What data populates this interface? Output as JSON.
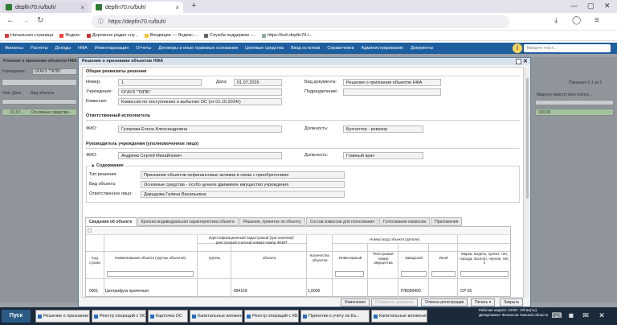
{
  "browser": {
    "tabs": [
      {
        "title": "depfin70.ru/buh/"
      },
      {
        "title": "depfin70.ru/buh/"
      }
    ],
    "address": "https://depfin70.ru/buh/",
    "bookmarks": [
      {
        "label": "Начальная страница",
        "color": "#e53935"
      },
      {
        "label": "Яндекс",
        "color": "#f44336"
      },
      {
        "label": "Дорожное радио слу...",
        "color": "#d32f2f"
      },
      {
        "label": "Входящие — Яндекс....",
        "color": "#fbc02d"
      },
      {
        "label": "Служба поддержки -...",
        "color": "#616161"
      },
      {
        "label": "https://buh.depfin70.r...",
        "color": "#90a4ae"
      }
    ]
  },
  "app": {
    "nav": [
      "Финансы",
      "Расчеты",
      "Доходы",
      "НФА",
      "Инвентаризация",
      "Отчеты",
      "Договоры и иные правовые основания",
      "Целевые средства",
      "Ввод остатков",
      "Справочники",
      "Администрирование",
      "Документы"
    ],
    "search_placeholder": "Введите текст..."
  },
  "background": {
    "title": "Решение о признании объектов НФА",
    "org_label": "Учреждение:",
    "org_value": "ОГАУЗ \"ТКПБ\"",
    "col_num": "Ном",
    "col_date": "Дата",
    "col_type": "Вид объекта",
    "row_date": "01.07...",
    "row_type": "Основные средства -",
    "shown": "Показано 1-1 из 1",
    "right_col": "Кварууп присутствие голосу...",
    "right_val": "100,00"
  },
  "dialog": {
    "title": "Решение о признании объектов НФА",
    "general": {
      "header": "Общие реквизиты решения",
      "num_label": "Номер:",
      "num_value": "1",
      "date_label": "Дата:",
      "date_value": "01.07.2026",
      "doctype_label": "Вид документа:",
      "doctype_value": "Решение о признании объектов НФА",
      "org_label": "Учреждение:",
      "org_value": "ОГАУЗ \"ТКПБ\"",
      "dept_label": "Подразделение:",
      "dept_value": "",
      "comm_label": "Комиссия:",
      "comm_value": "Комиссия по поступлению и выбытию ОС (от 01.10.2024г)"
    },
    "executor": {
      "header": "Ответственный исполнитель",
      "fio_label": "ФИО:",
      "fio_value": "Гучерова Елена Александровна",
      "pos_label": "Должность:",
      "pos_value": "Бухгалтер - ревизор"
    },
    "head": {
      "header": "Руководитель учреждения (уполномоченное лицо)",
      "fio_label": "ФИО:",
      "fio_value": "Андреев Сергей Михайлович",
      "pos_label": "Должность:",
      "pos_value": "Главный врач"
    },
    "content": {
      "header": "Содержание",
      "type_label": "Тип решения:",
      "type_value": "Признание объектов нефинансовых активов в связи с приобретением",
      "obj_label": "Вид объекта:",
      "obj_value": "Основные средства - особо ценное движимое имущество учреждения",
      "resp_label": "Ответственное лицо:",
      "resp_value": "Давыдова Галина Васильевна"
    },
    "tabs": [
      "Сведения об объекте",
      "Краткая индивидуальная характеристика объекта",
      "Решение, принятое по объекту",
      "Состав комиссии для голосования",
      "Голосование комиссии",
      "Приложения"
    ],
    "table": {
      "toolbar_hint": "",
      "hdr_idnum": "Идентификационный/ кадастровый (при наличии)/ реестровый/ учетный номер/ номер ФАИП",
      "hdr_code": "Номер (код) объекта (детали)",
      "hdr_kod": "Код строки",
      "hdr_name": "Наименование объекта (группы объектов)",
      "hdr_group": "группы",
      "hdr_object": "объекта",
      "hdr_qty": "Количество объектов",
      "hdr_inv": "Инвентарный",
      "hdr_reg": "Реестровый номер имущества",
      "hdr_fact": "Заводской",
      "hdr_other": "Иной",
      "hdr_brand": "Марка, модель, проект, тип, порода, паспорт, чертеж, тип, п",
      "row": {
        "kod": "0001",
        "name": "Центрифуга прачечная",
        "object": "894159",
        "qty": "1,0000",
        "fact": "Р/Б580400",
        "brand": "СР-25"
      }
    },
    "buttons": {
      "changes": "Изменения",
      "save": "Сохранить документ",
      "cancel_reg": "Отмена регистрации",
      "print": "Печать ▾",
      "close": "Закрыть"
    }
  },
  "taskbar": {
    "start": "Пуск",
    "items": [
      "Решение о признании об...",
      "Реестр операций с ОС",
      "Карточка ОС",
      "Капитальные вложения",
      "Реестр операций с КВ",
      "Принятие к учету из Ка...",
      "Капитальные вложения"
    ],
    "tray_line1": "Рабочая неделя: 12007. Об-ва(ты)",
    "tray_line2": "Департамент Финансов Томской области"
  },
  "colors": {
    "nav": "#1d5e9e",
    "taskbar": "#1b2a3a",
    "accent": "#ffd54f"
  }
}
